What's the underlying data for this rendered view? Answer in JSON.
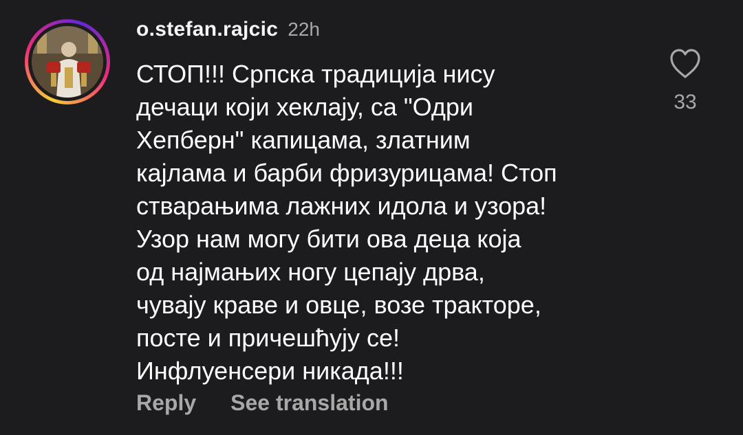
{
  "comment": {
    "avatar_icon": "avatar-photo",
    "username": "o.stefan.rajcic",
    "time": "22h",
    "text": "СТОП!!! Српска традиција нису\nдечаци који хеклају, са \"Одри\nХепберн\" капицама, златним\nкајлама и барби фризурицама! Стоп\nстварањима лажних идола и узора!\nУзор нам могу бити ова деца која\nод најмањих ногу цепају дрва,\nчувају краве и овце, возе тракторе,\nпосте и причешћују се!\nИнфлуенсери никада!!!",
    "reply_label": "Reply",
    "translate_label": "See translation",
    "like_icon": "heart-icon",
    "like_count": "33"
  },
  "colors": {
    "background": "#1c1c1f",
    "text": "#ffffff",
    "muted": "#a8a8a8",
    "ring_gradient": [
      "#f9ce34",
      "#ee2a7b",
      "#6228d7"
    ]
  }
}
